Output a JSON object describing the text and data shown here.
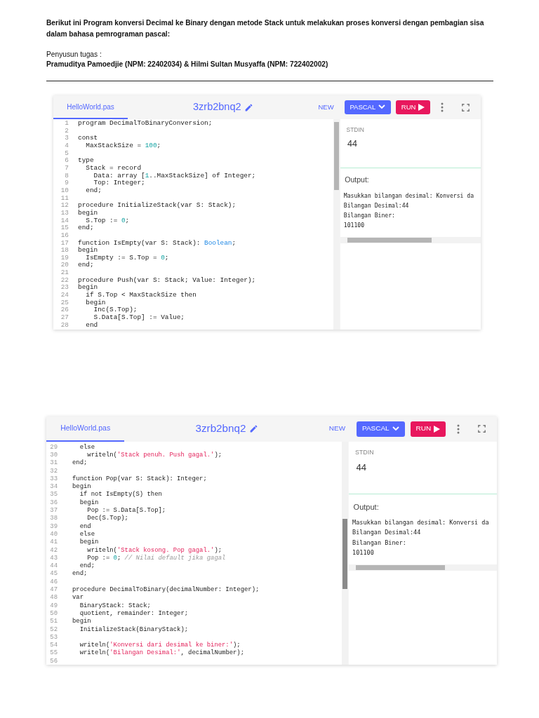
{
  "intro": {
    "paragraph": "Berikut ini Program konversi Decimal ke Binary dengan metode Stack untuk melakukan proses konversi dengan pembagian sisa dalam bahasa pemrograman pascal:",
    "author_label": "Penyusun tugas :",
    "authors": "Pramuditya Pamoedjie (NPM: 22402034) & Hilmi Sultan Musyaffa (NPM: 722402002)"
  },
  "screenshots": [
    {
      "tab": {
        "label": "HelloWorld.pas",
        "selected": true
      },
      "title": "3zrb2bnq2",
      "new_button": "NEW",
      "language_button": "PASCAL",
      "run_button": "RUN",
      "code_lines": [
        {
          "number": "1",
          "segments": [
            {
              "kind": "plain",
              "text": "program DecimalToBinaryConversion;"
            }
          ]
        },
        {
          "number": "2"
        },
        {
          "number": "3",
          "segments": [
            {
              "kind": "plain",
              "text": "const"
            }
          ]
        },
        {
          "number": "4",
          "segments": [
            {
              "kind": "plain",
              "text": "  MaxStackSize = "
            },
            {
              "kind": "number",
              "text": "100"
            },
            {
              "kind": "plain",
              "text": ";"
            }
          ]
        },
        {
          "number": "5"
        },
        {
          "number": "6",
          "segments": [
            {
              "kind": "plain",
              "text": "type"
            }
          ]
        },
        {
          "number": "7",
          "segments": [
            {
              "kind": "plain",
              "text": "  Stack = record"
            }
          ]
        },
        {
          "number": "8",
          "segments": [
            {
              "kind": "plain",
              "text": "    Data: array ["
            },
            {
              "kind": "number",
              "text": "1"
            },
            {
              "kind": "plain",
              "text": "..MaxStackSize] of Integer;"
            }
          ]
        },
        {
          "number": "9",
          "segments": [
            {
              "kind": "plain",
              "text": "    Top: Integer;"
            }
          ]
        },
        {
          "number": "10",
          "segments": [
            {
              "kind": "plain",
              "text": "  end;"
            }
          ]
        },
        {
          "number": "11"
        },
        {
          "number": "12",
          "segments": [
            {
              "kind": "plain",
              "text": "procedure InitializeStack(var S: Stack);"
            }
          ]
        },
        {
          "number": "13",
          "segments": [
            {
              "kind": "plain",
              "text": "begin"
            }
          ]
        },
        {
          "number": "14",
          "segments": [
            {
              "kind": "plain",
              "text": "  S.Top := "
            },
            {
              "kind": "number",
              "text": "0"
            },
            {
              "kind": "plain",
              "text": ";"
            }
          ]
        },
        {
          "number": "15",
          "segments": [
            {
              "kind": "plain",
              "text": "end;"
            }
          ]
        },
        {
          "number": "16"
        },
        {
          "number": "17",
          "segments": [
            {
              "kind": "plain",
              "text": "function IsEmpty(var S: Stack): "
            },
            {
              "kind": "type",
              "text": "Boolean"
            },
            {
              "kind": "plain",
              "text": ";"
            }
          ]
        },
        {
          "number": "18",
          "segments": [
            {
              "kind": "plain",
              "text": "begin"
            }
          ]
        },
        {
          "number": "19",
          "segments": [
            {
              "kind": "plain",
              "text": "  IsEmpty := S.Top = "
            },
            {
              "kind": "number",
              "text": "0"
            },
            {
              "kind": "plain",
              "text": ";"
            }
          ]
        },
        {
          "number": "20",
          "segments": [
            {
              "kind": "plain",
              "text": "end;"
            }
          ]
        },
        {
          "number": "21"
        },
        {
          "number": "22",
          "segments": [
            {
              "kind": "plain",
              "text": "procedure Push(var S: Stack; Value: Integer);"
            }
          ]
        },
        {
          "number": "23",
          "segments": [
            {
              "kind": "plain",
              "text": "begin"
            }
          ]
        },
        {
          "number": "24",
          "segments": [
            {
              "kind": "plain",
              "text": "  if S.Top < MaxStackSize then"
            }
          ]
        },
        {
          "number": "25",
          "segments": [
            {
              "kind": "plain",
              "text": "  begin"
            }
          ]
        },
        {
          "number": "26",
          "segments": [
            {
              "kind": "plain",
              "text": "    Inc(S.Top);"
            }
          ]
        },
        {
          "number": "27",
          "segments": [
            {
              "kind": "plain",
              "text": "    S.Data[S.Top] := Value;"
            }
          ]
        },
        {
          "number": "28",
          "segments": [
            {
              "kind": "plain",
              "text": "  end"
            }
          ]
        }
      ],
      "stdin_label": "STDIN",
      "stdin_value": "44",
      "output_label": "Output:",
      "output_lines": [
        "Masukkan bilangan desimal: Konversi da",
        "Bilangan Desimal:44",
        "Bilangan Biner:",
        "101100"
      ]
    },
    {
      "tab": {
        "label": "HelloWorld.pas",
        "selected": true
      },
      "title": "3zrb2bnq2",
      "new_button": "NEW",
      "language_button": "PASCAL",
      "run_button": "RUN",
      "code_lines": [
        {
          "number": "29",
          "segments": [
            {
              "kind": "plain",
              "text": "  else"
            }
          ]
        },
        {
          "number": "30",
          "segments": [
            {
              "kind": "plain",
              "text": "    writeln("
            },
            {
              "kind": "string",
              "text": "'Stack penuh. Push gagal.'"
            },
            {
              "kind": "plain",
              "text": ");"
            }
          ]
        },
        {
          "number": "31",
          "segments": [
            {
              "kind": "plain",
              "text": "end;"
            }
          ]
        },
        {
          "number": "32"
        },
        {
          "number": "33",
          "segments": [
            {
              "kind": "plain",
              "text": "function Pop(var S: Stack): Integer;"
            }
          ]
        },
        {
          "number": "34",
          "segments": [
            {
              "kind": "plain",
              "text": "begin"
            }
          ]
        },
        {
          "number": "35",
          "segments": [
            {
              "kind": "plain",
              "text": "  if not IsEmpty(S) then"
            }
          ]
        },
        {
          "number": "36",
          "segments": [
            {
              "kind": "plain",
              "text": "  begin"
            }
          ]
        },
        {
          "number": "37",
          "segments": [
            {
              "kind": "plain",
              "text": "    Pop := S.Data[S.Top];"
            }
          ]
        },
        {
          "number": "38",
          "segments": [
            {
              "kind": "plain",
              "text": "    Dec(S.Top);"
            }
          ]
        },
        {
          "number": "39",
          "segments": [
            {
              "kind": "plain",
              "text": "  end"
            }
          ]
        },
        {
          "number": "40",
          "segments": [
            {
              "kind": "plain",
              "text": "  else"
            }
          ]
        },
        {
          "number": "41",
          "segments": [
            {
              "kind": "plain",
              "text": "  begin"
            }
          ]
        },
        {
          "number": "42",
          "segments": [
            {
              "kind": "plain",
              "text": "    writeln("
            },
            {
              "kind": "string",
              "text": "'Stack kosong. Pop gagal.'"
            },
            {
              "kind": "plain",
              "text": ");"
            }
          ]
        },
        {
          "number": "43",
          "segments": [
            {
              "kind": "plain",
              "text": "    Pop := "
            },
            {
              "kind": "number",
              "text": "0"
            },
            {
              "kind": "plain",
              "text": "; "
            },
            {
              "kind": "comment",
              "text": "// Nilai default jika gagal"
            }
          ]
        },
        {
          "number": "44",
          "segments": [
            {
              "kind": "plain",
              "text": "  end;"
            }
          ]
        },
        {
          "number": "45",
          "segments": [
            {
              "kind": "plain",
              "text": "end;"
            }
          ]
        },
        {
          "number": "46"
        },
        {
          "number": "47",
          "segments": [
            {
              "kind": "plain",
              "text": "procedure DecimalToBinary(decimalNumber: Integer);"
            }
          ]
        },
        {
          "number": "48",
          "segments": [
            {
              "kind": "plain",
              "text": "var"
            }
          ]
        },
        {
          "number": "49",
          "segments": [
            {
              "kind": "plain",
              "text": "  BinaryStack: Stack;"
            }
          ]
        },
        {
          "number": "50",
          "segments": [
            {
              "kind": "plain",
              "text": "  quotient, remainder: Integer;"
            }
          ]
        },
        {
          "number": "51",
          "segments": [
            {
              "kind": "plain",
              "text": "begin"
            }
          ]
        },
        {
          "number": "52",
          "segments": [
            {
              "kind": "plain",
              "text": "  InitializeStack(BinaryStack);"
            }
          ]
        },
        {
          "number": "53"
        },
        {
          "number": "54",
          "segments": [
            {
              "kind": "plain",
              "text": "  writeln("
            },
            {
              "kind": "string",
              "text": "'Konversi dari desimal ke biner:'"
            },
            {
              "kind": "plain",
              "text": ");"
            }
          ]
        },
        {
          "number": "55",
          "segments": [
            {
              "kind": "plain",
              "text": "  writeln("
            },
            {
              "kind": "string",
              "text": "'Bilangan Desimal:'"
            },
            {
              "kind": "plain",
              "text": ", decimalNumber);"
            }
          ]
        },
        {
          "number": "56"
        }
      ],
      "stdin_label": "STDIN",
      "stdin_value": "44",
      "output_label": "Output:",
      "output_lines": [
        "Masukkan bilangan desimal: Konversi da",
        "Bilangan Desimal:44",
        "Bilangan Biner:",
        "101100"
      ]
    }
  ]
}
